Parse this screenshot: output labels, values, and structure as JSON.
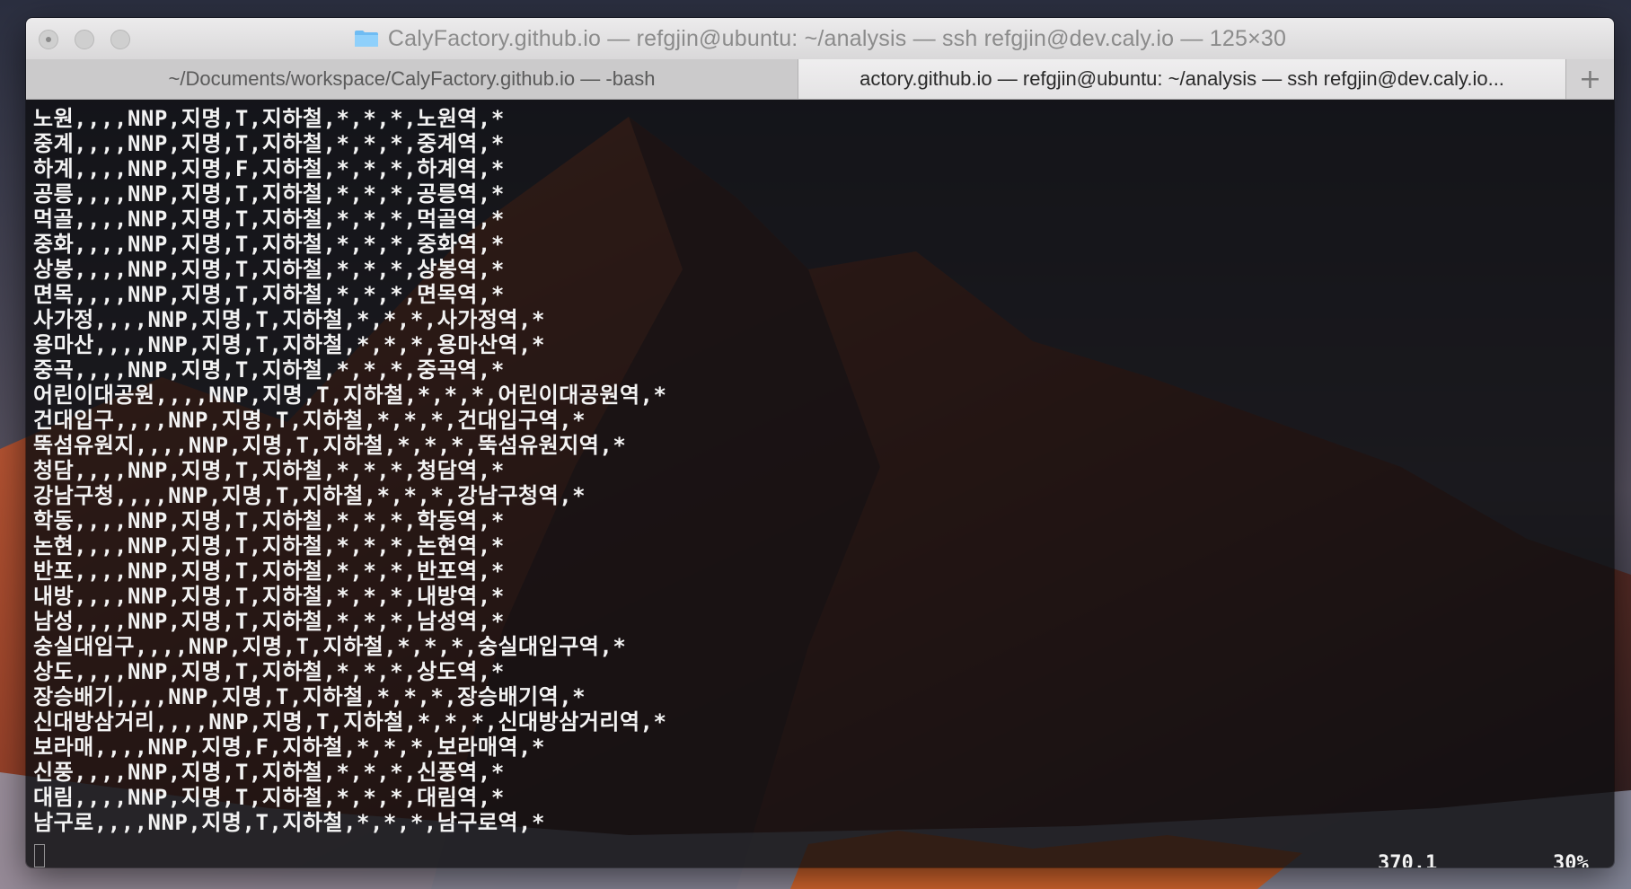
{
  "window": {
    "title": "CalyFactory.github.io — refgjin@ubuntu: ~/analysis — ssh refgjin@dev.caly.io — 125×30",
    "folder_icon": "folder-icon"
  },
  "tabs": [
    {
      "label": "~/Documents/workspace/CalyFactory.github.io — -bash",
      "active": false
    },
    {
      "label": "...actory.github.io — refgjin@ubuntu: ~/analysis — ssh refgjin@dev.caly.io",
      "active": true
    }
  ],
  "new_tab_label": "+",
  "terminal": {
    "lines": [
      "노원,,,,NNP,지명,T,지하철,*,*,*,노원역,*",
      "중계,,,,NNP,지명,T,지하철,*,*,*,중계역,*",
      "하계,,,,NNP,지명,F,지하철,*,*,*,하계역,*",
      "공릉,,,,NNP,지명,T,지하철,*,*,*,공릉역,*",
      "먹골,,,,NNP,지명,T,지하철,*,*,*,먹골역,*",
      "중화,,,,NNP,지명,T,지하철,*,*,*,중화역,*",
      "상봉,,,,NNP,지명,T,지하철,*,*,*,상봉역,*",
      "면목,,,,NNP,지명,T,지하철,*,*,*,면목역,*",
      "사가정,,,,NNP,지명,T,지하철,*,*,*,사가정역,*",
      "용마산,,,,NNP,지명,T,지하철,*,*,*,용마산역,*",
      "중곡,,,,NNP,지명,T,지하철,*,*,*,중곡역,*",
      "어린이대공원,,,,NNP,지명,T,지하철,*,*,*,어린이대공원역,*",
      "건대입구,,,,NNP,지명,T,지하철,*,*,*,건대입구역,*",
      "뚝섬유원지,,,,NNP,지명,T,지하철,*,*,*,뚝섬유원지역,*",
      "청담,,,,NNP,지명,T,지하철,*,*,*,청담역,*",
      "강남구청,,,,NNP,지명,T,지하철,*,*,*,강남구청역,*",
      "학동,,,,NNP,지명,T,지하철,*,*,*,학동역,*",
      "논현,,,,NNP,지명,T,지하철,*,*,*,논현역,*",
      "반포,,,,NNP,지명,T,지하철,*,*,*,반포역,*",
      "내방,,,,NNP,지명,T,지하철,*,*,*,내방역,*",
      "남성,,,,NNP,지명,T,지하철,*,*,*,남성역,*",
      "숭실대입구,,,,NNP,지명,T,지하철,*,*,*,숭실대입구역,*",
      "상도,,,,NNP,지명,T,지하철,*,*,*,상도역,*",
      "장승배기,,,,NNP,지명,T,지하철,*,*,*,장승배기역,*",
      "신대방삼거리,,,,NNP,지명,T,지하철,*,*,*,신대방삼거리역,*",
      "보라매,,,,NNP,지명,F,지하철,*,*,*,보라매역,*",
      "신풍,,,,NNP,지명,T,지하철,*,*,*,신풍역,*",
      "대림,,,,NNP,지명,T,지하철,*,*,*,대림역,*",
      "남구로,,,,NNP,지명,T,지하철,*,*,*,남구로역,*"
    ],
    "cursor_position": "370,1",
    "scroll_percent": "30%"
  },
  "colors": {
    "terminal_text": "#f3f3f3",
    "terminal_bg": "#0e0d10",
    "titlebar": "#e3e2e3",
    "folder": "#5ab0f0"
  }
}
